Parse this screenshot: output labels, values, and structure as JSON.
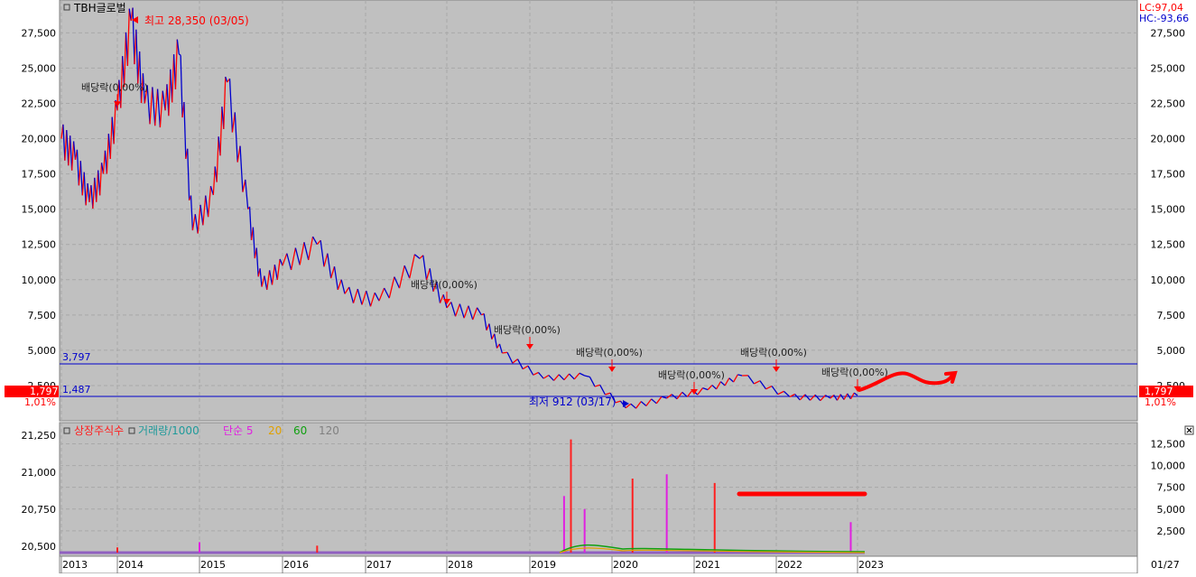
{
  "stock_name": "TBH글로벌",
  "lc_label": "LC:97,04",
  "hc_label": "HC:-93,66",
  "max_label": "최고 28,350 (03/05)",
  "min_label": "최저 912 (03/17)",
  "current_price": "1,797",
  "current_pct": "1,01%",
  "upper_hline": "3,797",
  "lower_hline": "1,487",
  "dividend_label": "배당락(0,00%)",
  "end_date_label": "01/27",
  "close_icon": "close-icon",
  "volume_legend": [
    {
      "label": "상장주식수",
      "color": "#ff2020"
    },
    {
      "label": "거래량/1000",
      "color": "#1f9a9a"
    },
    {
      "label": "단순 5",
      "color": "#e020e0"
    },
    {
      "label": "20",
      "color": "#e0a000"
    },
    {
      "label": "60",
      "color": "#10a010"
    },
    {
      "label": "120",
      "color": "#808080"
    }
  ],
  "colors": {
    "up": "#ff0000",
    "down": "#0000cc",
    "background": "#c0c0c0",
    "hline": "#0000cc",
    "annotation": "#ff0000"
  },
  "chart_data": [
    {
      "type": "line",
      "title": "TBH글로벌",
      "x_ticks": [
        "2013",
        "2014",
        "2015",
        "2016",
        "2017",
        "2018",
        "2019",
        "2020",
        "2021",
        "2022",
        "2023"
      ],
      "y_ticks": [
        "27,500",
        "25,000",
        "22,500",
        "20,000",
        "17,500",
        "15,000",
        "12,500",
        "10,000",
        "7,500",
        "5,000",
        "2,500"
      ],
      "ylim": [
        0,
        28800
      ],
      "series": [
        {
          "values": [
            [
              "2013-01",
              20000
            ],
            [
              "2013-04",
              18500
            ],
            [
              "2013-07",
              15500
            ],
            [
              "2013-10",
              17500
            ],
            [
              "2014-01",
              22000
            ],
            [
              "2014-03",
              28350
            ],
            [
              "2014-05",
              22500
            ],
            [
              "2014-08",
              22000
            ],
            [
              "2014-10",
              26000
            ],
            [
              "2014-12",
              13500
            ],
            [
              "2015-03",
              16000
            ],
            [
              "2015-05",
              24000
            ],
            [
              "2015-08",
              15000
            ],
            [
              "2015-10",
              9500
            ],
            [
              "2016-01",
              11000
            ],
            [
              "2016-06",
              12500
            ],
            [
              "2016-10",
              9000
            ],
            [
              "2017-03",
              8500
            ],
            [
              "2017-09",
              11500
            ],
            [
              "2018-01",
              8000
            ],
            [
              "2018-06",
              7500
            ],
            [
              "2018-09",
              4800
            ],
            [
              "2019-03",
              3000
            ],
            [
              "2019-09",
              3200
            ],
            [
              "2020-03",
              912
            ],
            [
              "2020-09",
              1600
            ],
            [
              "2021-03",
              2200
            ],
            [
              "2021-08",
              3200
            ],
            [
              "2022-03",
              1700
            ],
            [
              "2022-09",
              1600
            ],
            [
              "2023-01",
              1797
            ]
          ]
        }
      ],
      "dividend_markers": [
        "2014-01",
        "2018-01",
        "2019-01",
        "2020-01",
        "2021-01",
        "2022-01",
        "2023-01"
      ]
    },
    {
      "type": "bar",
      "title": "상장주식수 / 거래량",
      "left_ticks": [
        "21,250",
        "21,000",
        "20,750",
        "20,500"
      ],
      "right_ticks": [
        "12,500",
        "10,000",
        "7,500",
        "5,000",
        "2,500"
      ],
      "ylim": [
        0,
        14000
      ],
      "volume_spikes": [
        [
          "2014-01",
          600
        ],
        [
          "2015-01",
          1200
        ],
        [
          "2016-06",
          800
        ],
        [
          "2019-06",
          6500
        ],
        [
          "2019-07",
          13000
        ],
        [
          "2019-09",
          5000
        ],
        [
          "2020-04",
          8500
        ],
        [
          "2020-09",
          9000
        ],
        [
          "2021-04",
          8000
        ],
        [
          "2022-12",
          3500
        ]
      ]
    }
  ]
}
